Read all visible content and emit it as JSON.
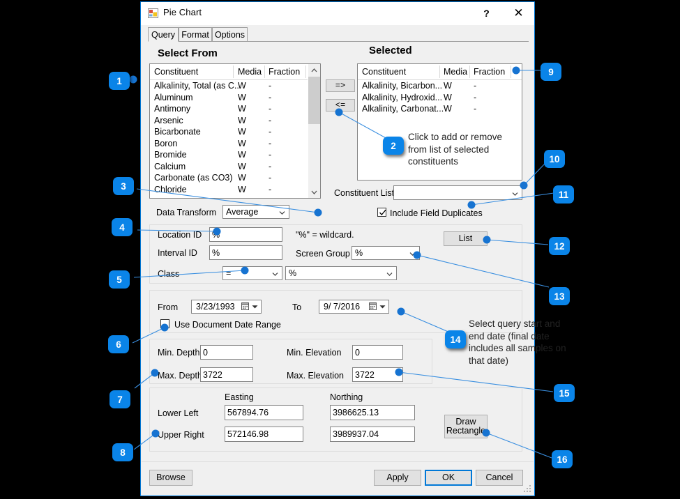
{
  "window": {
    "title": "Pie Chart",
    "icon": "form-window-icon",
    "help_label": "?",
    "close_label": "✕"
  },
  "tabs": [
    {
      "label": "Query",
      "active": true
    },
    {
      "label": "Format",
      "active": false
    },
    {
      "label": "Options",
      "active": false
    }
  ],
  "select_from": {
    "heading": "Select From",
    "columns": [
      "Constituent",
      "Media",
      "Fraction"
    ],
    "rows": [
      {
        "constituent": "Alkalinity, Total (as C...",
        "media": "W",
        "fraction": "-"
      },
      {
        "constituent": "Aluminum",
        "media": "W",
        "fraction": "-"
      },
      {
        "constituent": "Antimony",
        "media": "W",
        "fraction": "-"
      },
      {
        "constituent": "Arsenic",
        "media": "W",
        "fraction": "-"
      },
      {
        "constituent": "Bicarbonate",
        "media": "W",
        "fraction": "-"
      },
      {
        "constituent": "Boron",
        "media": "W",
        "fraction": "-"
      },
      {
        "constituent": "Bromide",
        "media": "W",
        "fraction": "-"
      },
      {
        "constituent": "Calcium",
        "media": "W",
        "fraction": "-"
      },
      {
        "constituent": "Carbonate (as CO3)",
        "media": "W",
        "fraction": "-"
      },
      {
        "constituent": "Chloride",
        "media": "W",
        "fraction": "-"
      }
    ]
  },
  "transfer": {
    "add_label": "=>",
    "remove_label": "<="
  },
  "selected": {
    "heading": "Selected",
    "columns": [
      "Constituent",
      "Media",
      "Fraction"
    ],
    "rows": [
      {
        "constituent": "Alkalinity, Bicarbon...",
        "media": "W",
        "fraction": "-"
      },
      {
        "constituent": "Alkalinity, Hydroxid...",
        "media": "W",
        "fraction": "-"
      },
      {
        "constituent": "Alkalinity, Carbonat...",
        "media": "W",
        "fraction": "-"
      }
    ]
  },
  "constituent_list": {
    "label": "Constituent List",
    "value": ""
  },
  "include_field_duplicates": {
    "label": "Include Field Duplicates",
    "checked": true
  },
  "data_transform": {
    "label": "Data Transform",
    "value": "Average"
  },
  "filters": {
    "location_id_label": "Location ID",
    "location_id_value": "%",
    "interval_id_label": "Interval ID",
    "interval_id_value": "%",
    "wildcard_note": "\"%\" = wildcard.",
    "screen_group_label": "Screen Group",
    "screen_group_value": "%",
    "class_label": "Class",
    "class_operator": "=",
    "class_value": "%",
    "list_button": "List"
  },
  "dates": {
    "from_label": "From",
    "from_value": "3/23/1993",
    "to_label": "To",
    "to_value": "9/ 7/2016",
    "use_document_range_label": "Use Document Date Range",
    "use_document_range_checked": false
  },
  "depth": {
    "min_depth_label": "Min. Depth",
    "min_depth_value": "0",
    "max_depth_label": "Max. Depth",
    "max_depth_value": "3722",
    "min_elevation_label": "Min. Elevation",
    "min_elevation_value": "0",
    "max_elevation_label": "Max. Elevation",
    "max_elevation_value": "3722"
  },
  "coordinates": {
    "easting_header": "Easting",
    "northing_header": "Northing",
    "lower_left_label": "Lower Left",
    "lower_left_easting": "567894.76",
    "lower_left_northing": "3986625.13",
    "upper_right_label": "Upper Right",
    "upper_right_easting": "572146.98",
    "upper_right_northing": "3989937.04",
    "draw_rectangle_label": "Draw\nRectangle"
  },
  "footer": {
    "browse": "Browse",
    "apply": "Apply",
    "ok": "OK",
    "cancel": "Cancel"
  },
  "annotations": {
    "accent_color": "#0a84e8",
    "badges": [
      {
        "num": "1"
      },
      {
        "num": "2"
      },
      {
        "num": "3"
      },
      {
        "num": "4"
      },
      {
        "num": "5"
      },
      {
        "num": "6"
      },
      {
        "num": "7"
      },
      {
        "num": "8"
      },
      {
        "num": "9"
      },
      {
        "num": "10"
      },
      {
        "num": "11"
      },
      {
        "num": "12"
      },
      {
        "num": "13"
      },
      {
        "num": "14"
      },
      {
        "num": "15"
      },
      {
        "num": "16"
      }
    ],
    "note_transfer": "Click to add or remove\nfrom list of selected\nconstituents",
    "note_dates": "Select query start and\nend date (final date\nincludes all samples on\nthat date)"
  }
}
